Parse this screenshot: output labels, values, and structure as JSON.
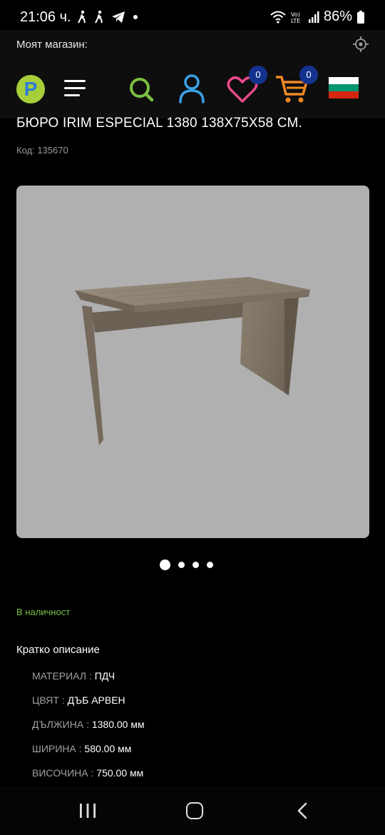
{
  "status_bar": {
    "time": "21:06 ч.",
    "battery": "86%"
  },
  "store_bar": {
    "label": "Моят магазин:"
  },
  "header": {
    "wishlist_count": "0",
    "cart_count": "0"
  },
  "product": {
    "title": "БЮРО IRIM ESPECIAL 1380 138X75X58 СМ.",
    "code": "Код: 135670",
    "availability": "В наличност",
    "short_description_title": "Кратко описание",
    "specs": [
      {
        "key": "МАТЕРИАЛ : ",
        "value": "ПДЧ"
      },
      {
        "key": "ЦВЯТ : ",
        "value": "ДЪБ АРВЕН"
      },
      {
        "key": "ДЪЛЖИНА : ",
        "value": "1380.00 мм"
      },
      {
        "key": "ШИРИНА : ",
        "value": "580.00 мм"
      },
      {
        "key": "ВИСОЧИНА : ",
        "value": "750.00 мм"
      }
    ]
  },
  "gallery": {
    "slide_count": 4,
    "active_slide": 1
  },
  "colors": {
    "logo_green": "#a6cf3a",
    "logo_blue": "#2e7bd6",
    "search_green": "#7bc043",
    "user_blue": "#3aa0e8",
    "heart_pink": "#e84a8a",
    "cart_orange": "#f08a24",
    "badge_blue": "#14338f",
    "stock_green": "#7bc043"
  },
  "icons": [
    "locate-icon",
    "logo",
    "menu-icon",
    "search-icon",
    "user-icon",
    "heart-icon",
    "cart-icon",
    "bulgaria-flag-icon",
    "recent-apps-icon",
    "home-icon",
    "back-icon"
  ]
}
